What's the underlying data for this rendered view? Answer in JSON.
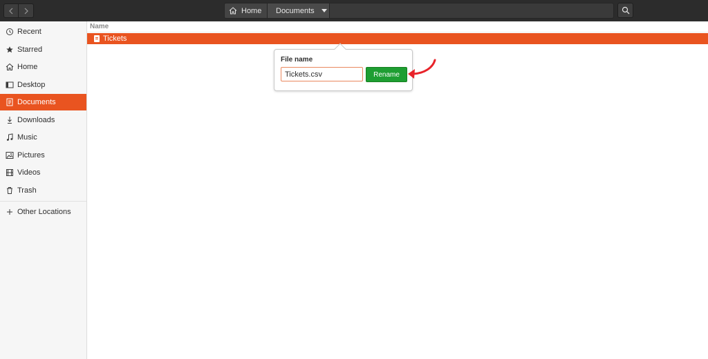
{
  "header": {
    "breadcrumbs": [
      "Home",
      "Documents"
    ],
    "icons": {
      "back": "chevron-left-icon",
      "forward": "chevron-right-icon",
      "home": "home-icon",
      "search": "search-icon"
    }
  },
  "sidebar": {
    "items": [
      {
        "label": "Recent",
        "icon": "clock-icon"
      },
      {
        "label": "Starred",
        "icon": "star-icon"
      },
      {
        "label": "Home",
        "icon": "home-icon"
      },
      {
        "label": "Desktop",
        "icon": "desktop-icon"
      },
      {
        "label": "Documents",
        "icon": "document-icon",
        "active": true
      },
      {
        "label": "Downloads",
        "icon": "download-icon"
      },
      {
        "label": "Music",
        "icon": "music-icon"
      },
      {
        "label": "Pictures",
        "icon": "picture-icon"
      },
      {
        "label": "Videos",
        "icon": "video-icon"
      },
      {
        "label": "Trash",
        "icon": "trash-icon"
      },
      {
        "label": "Other Locations",
        "icon": "plus-icon"
      }
    ]
  },
  "main": {
    "column_header": "Name",
    "files": [
      {
        "name": "Tickets",
        "selected": true
      }
    ]
  },
  "rename_popover": {
    "label": "File name",
    "input_value": "Tickets.csv",
    "button_label": "Rename"
  },
  "colors": {
    "accent": "#e95420",
    "rename_button": "#1e9e32",
    "annotation_arrow": "#e8232a",
    "headerbar": "#2c2c2c"
  }
}
